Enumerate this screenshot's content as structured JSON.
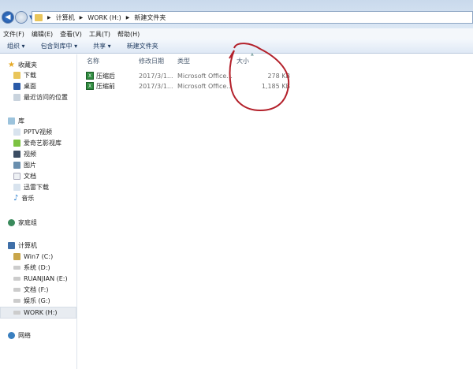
{
  "address": {
    "crumbs": [
      "计算机",
      "WORK (H:)",
      "新建文件夹"
    ]
  },
  "menu": [
    "文件(F)",
    "编辑(E)",
    "查看(V)",
    "工具(T)",
    "帮助(H)"
  ],
  "toolbar": {
    "organize": "组织 ▾",
    "include": "包含到库中 ▾",
    "share": "共享 ▾",
    "new_folder": "新建文件夹"
  },
  "columns": {
    "name": "名称",
    "date": "修改日期",
    "type": "类型",
    "size": "大小"
  },
  "files": [
    {
      "name": "压缩后",
      "date": "2017/3/1...",
      "type": "Microsoft Office...",
      "size": "278 KB"
    },
    {
      "name": "压缩前",
      "date": "2017/3/1...",
      "type": "Microsoft Office...",
      "size": "1,185 KB"
    }
  ],
  "sidebar": {
    "favorites": "收藏夹",
    "fav_items": [
      "下载",
      "桌面",
      "最近访问的位置"
    ],
    "libraries": "库",
    "lib_items": [
      "PPTV视频",
      "爱奇艺影视库",
      "视频",
      "图片",
      "文档",
      "迅雷下载",
      "音乐"
    ],
    "homegroup": "家庭组",
    "computer": "计算机",
    "drives": [
      "Win7 (C:)",
      "系统 (D:)",
      "RUANJIAN (E:)",
      "文档 (F:)",
      "娱乐 (G:)",
      "WORK (H:)"
    ],
    "network": "网络"
  },
  "annotation_color": "#b3202a"
}
